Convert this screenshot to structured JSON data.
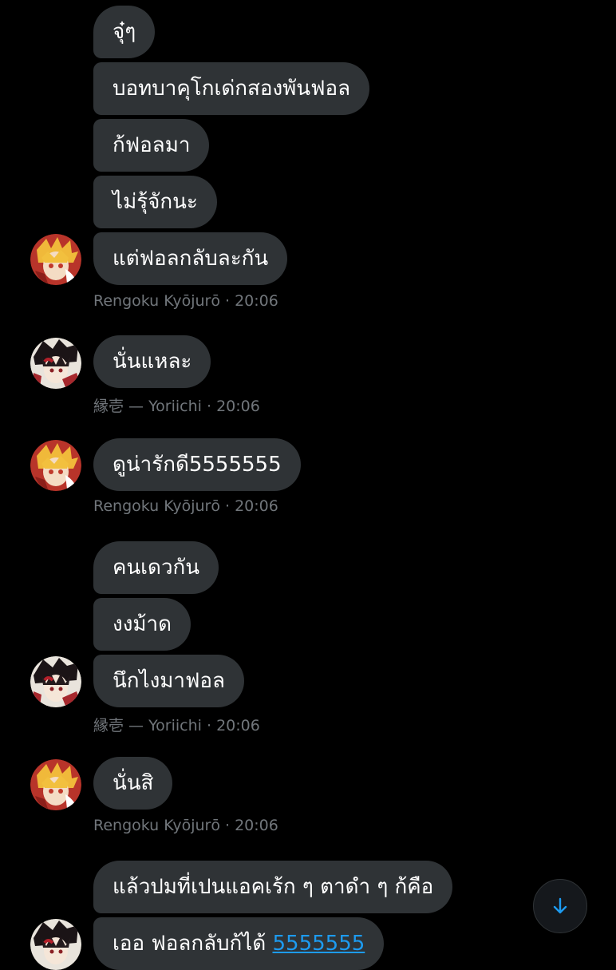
{
  "messages": {
    "group1": {
      "bubbles": [
        "จุ๋ๆ",
        "บอทบาคุโกเด่กสองพันฟอล",
        "ก้ฟอลมา",
        "ไม่รุ้จักนะ",
        "แต่ฟอลกลับละกัน"
      ],
      "sender": "Rengoku Kyōjurō",
      "time": "· 20:06",
      "avatar_icon": "rengoku-avatar"
    },
    "group2": {
      "bubbles": [
        "นั่นแหละ"
      ],
      "sender": "縁壱 — Yoriichi",
      "time": "· 20:06",
      "avatar_icon": "yoriichi-avatar"
    },
    "group3": {
      "bubbles": [
        "ดูน่ารักดี5555555"
      ],
      "sender": "Rengoku Kyōjurō",
      "time": "· 20:06",
      "avatar_icon": "rengoku-avatar"
    },
    "group4": {
      "bubbles": [
        "คนเดวกัน",
        "งงม้าด",
        "นึกไงมาฟอล"
      ],
      "sender": "縁壱 — Yoriichi",
      "time": "· 20:06",
      "avatar_icon": "yoriichi-avatar"
    },
    "group5": {
      "bubbles": [
        "นั่นสิ"
      ],
      "sender": "Rengoku Kyōjurō",
      "time": "· 20:06",
      "avatar_icon": "rengoku-avatar"
    },
    "group6": {
      "bubbles": [
        "แล้วปมที่เปนแอคเร้ก ๆ ตาดำ ๆ ก้คือ",
        "เออ ฟอลกลับก้ได้ "
      ],
      "link_text": "5555555",
      "avatar_icon": "yoriichi-avatar"
    }
  },
  "scroll_button": {
    "icon": "arrow-down-icon"
  },
  "colors": {
    "background": "#000000",
    "bubble": "#2f3336",
    "meta_text": "#71767b",
    "link": "#1d9bf0"
  }
}
